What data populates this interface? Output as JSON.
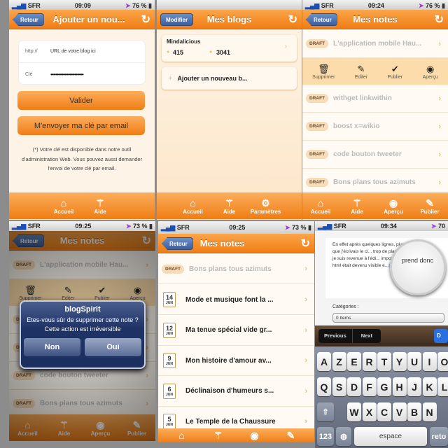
{
  "panel1": {
    "status": {
      "carrier": "SFR",
      "time": "09:09",
      "battery": "76 %"
    },
    "nav": {
      "back": "Retour",
      "title": "Ajouter un nou..."
    },
    "form": {
      "url_label": "http://",
      "url_placeholder": "URL de votre blog ici",
      "key_label": "Clé",
      "key_value": "••••••••••••••••••••••••••"
    },
    "validate": "Valider",
    "send_key": "M'envoyer ma clé par email",
    "note": "(*) Votre clé est disponible dans notre outil d'administration Web. Vous pouvez aussi demander l'envoi de votre clé par email.",
    "tabs": [
      {
        "icon": "home-icon",
        "label": "Accueil"
      },
      {
        "icon": "magic-wand-icon",
        "label": "Aide"
      }
    ]
  },
  "panel2": {
    "nav": {
      "edit": "Modifier",
      "title": "Mes blogs"
    },
    "blog": {
      "name": "Mindalicious",
      "notes": "415",
      "comments": "3041"
    },
    "add": "Ajouter un nouveau b...",
    "tabs": [
      {
        "icon": "home-icon",
        "label": "Accueil"
      },
      {
        "icon": "magic-wand-icon",
        "label": "Aide"
      },
      {
        "icon": "gears-icon",
        "label": "Paramètres"
      }
    ]
  },
  "panel3": {
    "status": {
      "carrier": "SFR",
      "time": "09:24",
      "battery": "76 %"
    },
    "nav": {
      "back": "Retour",
      "title": "Mes notes"
    },
    "badge": "DRAFT",
    "notes": [
      "L'application mobile Hau...",
      "withget linkwithin",
      "boost x=wikio",
      "code bouton tweeter",
      "Bons plans tous azimuts"
    ],
    "actions": [
      {
        "icon": "trash-icon",
        "label": "Supprimer"
      },
      {
        "icon": "pencil-icon",
        "label": "Editer"
      },
      {
        "icon": "check-icon",
        "label": "Publier"
      },
      {
        "icon": "eye-icon",
        "label": "Aperçu"
      }
    ],
    "tabs": [
      {
        "icon": "home-icon",
        "label": "Accueil"
      },
      {
        "icon": "magic-wand-icon",
        "label": "Aide"
      },
      {
        "icon": "eye-icon",
        "label": "Aperçu"
      },
      {
        "icon": "pencil-icon",
        "label": "Publier"
      }
    ]
  },
  "panel4": {
    "status": {
      "carrier": "SFR",
      "time": "09:25",
      "battery": "73 %"
    },
    "alert": {
      "title": "blogSpirit",
      "message": "Etes-vous sûr de supprimer cette note ? Cette action est irréversible",
      "cancel": "Non",
      "ok": "Oui"
    }
  },
  "panel5": {
    "status": {
      "carrier": "SFR",
      "time": "09:25",
      "battery": "73 %"
    },
    "nav": {
      "back": "Retour",
      "title": "Mes notes"
    },
    "draft": {
      "badge": "DRAFT",
      "title": "Bons plans tous azimuts"
    },
    "posts": [
      {
        "day": "14",
        "month": "JUN",
        "title": "Mode et musique font la ..."
      },
      {
        "day": "12",
        "month": "JUN",
        "title": "Ma tenue spécial vide gr..."
      },
      {
        "day": "9",
        "month": "JUN",
        "title": "Mon histoire d'amour av..."
      },
      {
        "day": "6",
        "month": "JUN",
        "title": "Déclinaison d'humeurs s..."
      },
      {
        "day": "5",
        "month": "JUN",
        "title": "Le Temple de la Chaussure"
      }
    ]
  },
  "panel6": {
    "status": {
      "carrier": "SFR",
      "time": "09:34",
      "battery": "70"
    },
    "body_text": "En effet après quelques lignes, plus que de lire ce que j'écrivais le cl... trop de place. J'ai sauvé m... puis je suis revenue à l'édi... impossible de \"scroller\" d... le html était devenu visible e...",
    "magnifier": "prend donc",
    "categories_label": "Catégories :",
    "categories_value": "0 Items",
    "toolbar": {
      "previous": "Previous",
      "next": "Next",
      "done": "D"
    },
    "keyboard": {
      "row1": [
        "A",
        "Z",
        "E",
        "R",
        "T",
        "Y",
        "U",
        "I",
        "O"
      ],
      "row2": [
        "Q",
        "S",
        "D",
        "F",
        "G",
        "H",
        "J",
        "K",
        "L"
      ],
      "row3": [
        "W",
        "X",
        "C",
        "V",
        "B",
        "N"
      ],
      "numbers": "123",
      "space": "espace",
      "return": "reto"
    }
  },
  "colors": {
    "accent": "#f07d14",
    "button_blue": "#3b5f9e",
    "background": "#fdf3e6"
  }
}
